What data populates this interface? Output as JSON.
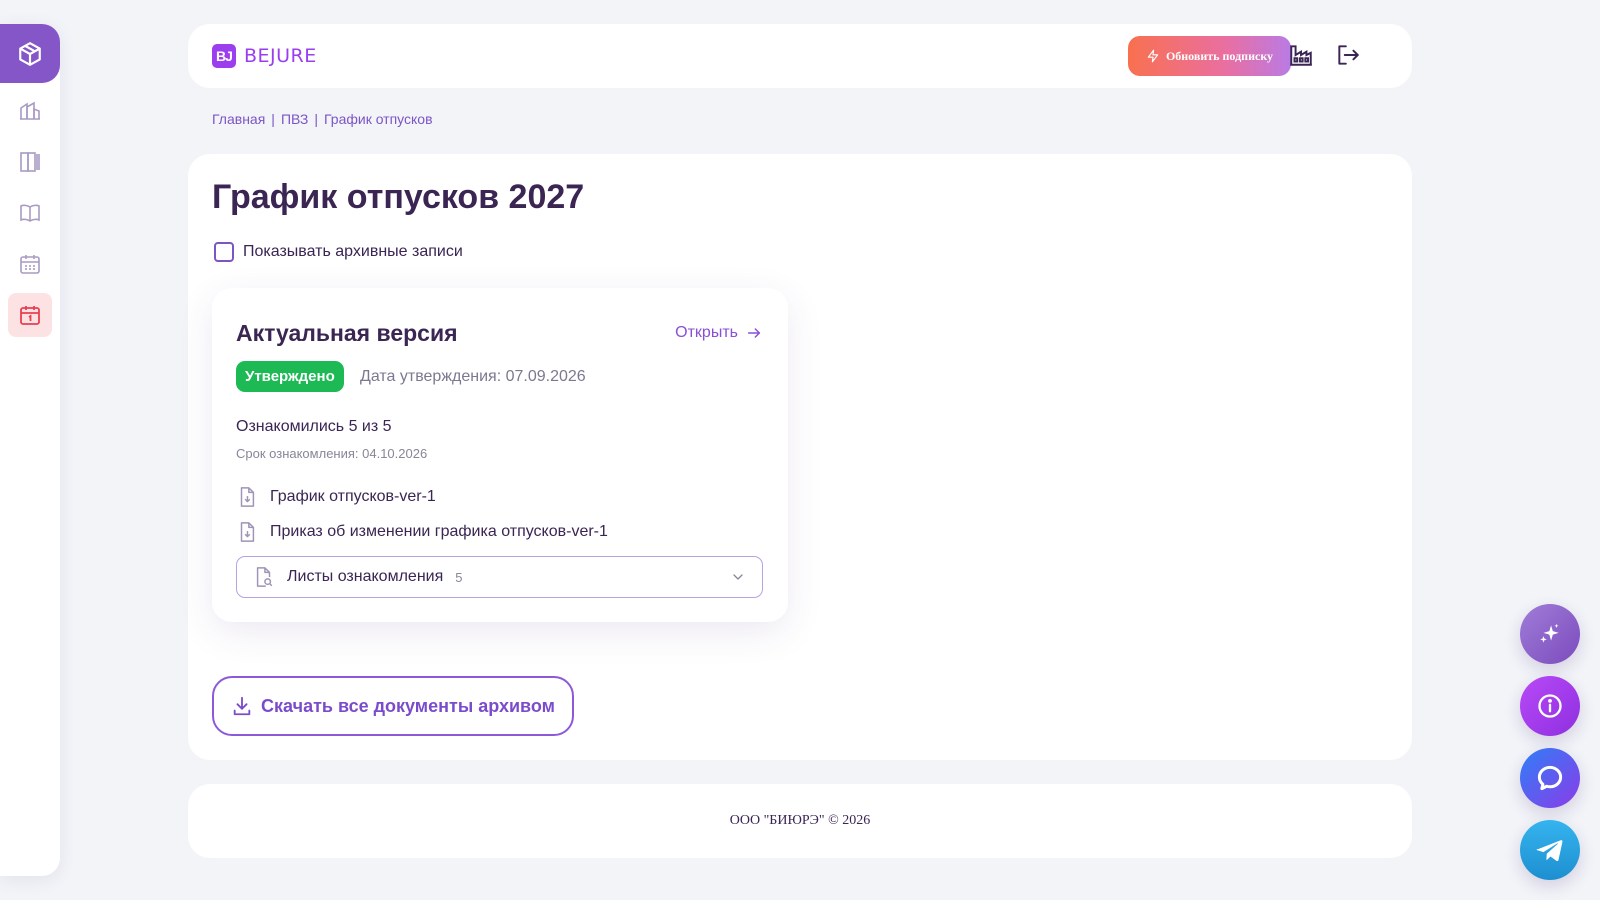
{
  "sidebar": {
    "items": [
      {
        "icon": "cube-icon"
      },
      {
        "icon": "buildings-icon"
      },
      {
        "icon": "journals-icon"
      },
      {
        "icon": "book-icon"
      },
      {
        "icon": "calendar-grid-icon"
      },
      {
        "icon": "calendar-one-icon"
      }
    ],
    "active_color": "#fde2e4",
    "logo_color": "#8456c7"
  },
  "header": {
    "brand_badge": "BJ",
    "brand_name": "BEJURE",
    "upgrade_label": "Обновить подписку",
    "icons": [
      "factory-icon",
      "logout-icon"
    ]
  },
  "breadcrumb": {
    "items": [
      "Главная",
      "ПВЗ",
      "График отпусков"
    ],
    "separator": "|"
  },
  "page": {
    "title": "График отпусков 2027",
    "archive_checkbox_label": "Показывать архивные записи",
    "archive_checked": false
  },
  "card": {
    "title": "Актуальная версия",
    "open_label": "Открыть",
    "status": "Утверждено",
    "status_color": "#1db954",
    "approval_date": "Дата утверждения: 07.09.2026",
    "ack_count": "Ознакомились 5 из 5",
    "ack_deadline": "Срок ознакомления: 04.10.2026",
    "documents": [
      "График отпусков-ver-1",
      "Приказ об изменении графика отпусков-ver-1"
    ],
    "sheets_label": "Листы ознакомления",
    "sheets_count": "5"
  },
  "download_label": "Скачать все документы архивом",
  "footer": {
    "text": "ООО \"БИЮРЭ\" © 2026"
  },
  "fabs": [
    "sparkle-icon",
    "info-icon",
    "chat-icon",
    "telegram-icon"
  ],
  "colors": {
    "accent": "#8c5ad8",
    "title": "#3a2553",
    "background": "#f2f4f8"
  }
}
